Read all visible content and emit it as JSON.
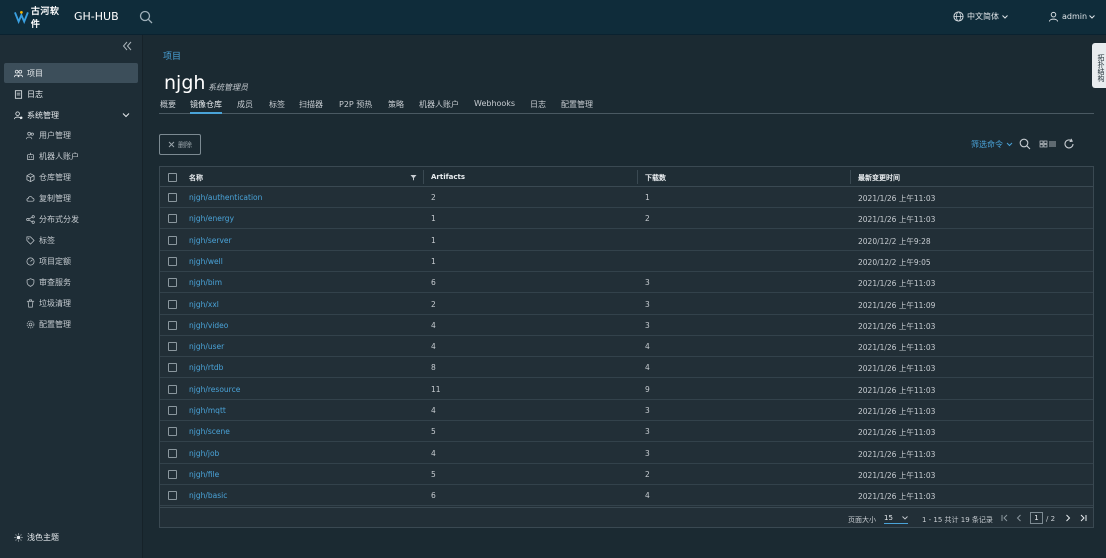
{
  "header": {
    "logo_text": "古河软件",
    "brand": "GH-HUB",
    "language": "中文简体",
    "user": "admin"
  },
  "sidebar": {
    "items": [
      {
        "label": "项目"
      },
      {
        "label": "日志"
      },
      {
        "label": "系统管理"
      }
    ],
    "sub_items": [
      {
        "label": "用户管理"
      },
      {
        "label": "机器人账户"
      },
      {
        "label": "仓库管理"
      },
      {
        "label": "复制管理"
      },
      {
        "label": "分布式分发"
      },
      {
        "label": "标签"
      },
      {
        "label": "项目定额"
      },
      {
        "label": "审查服务"
      },
      {
        "label": "垃圾清理"
      },
      {
        "label": "配置管理"
      }
    ],
    "theme": "浅色主题"
  },
  "breadcrumb": "项目",
  "project": {
    "name": "njgh",
    "role": "系统管理员"
  },
  "tabs": [
    "概要",
    "镜像仓库",
    "成员",
    "标签",
    "扫描器",
    "P2P 预热",
    "策略",
    "机器人账户",
    "Webhooks",
    "日志",
    "配置管理"
  ],
  "side_tab": "拓扑结构",
  "toolbar": {
    "delete_label": "删除",
    "filter_label": "筛选命令"
  },
  "table": {
    "columns": [
      "名称",
      "Artifacts",
      "下载数",
      "最新变更时间"
    ],
    "rows": [
      {
        "name": "njgh/authentication",
        "artifacts": "2",
        "pulls": "1",
        "time": "2021/1/26 上午11:03"
      },
      {
        "name": "njgh/energy",
        "artifacts": "1",
        "pulls": "2",
        "time": "2021/1/26 上午11:03"
      },
      {
        "name": "njgh/server",
        "artifacts": "1",
        "pulls": "",
        "time": "2020/12/2 上午9:28"
      },
      {
        "name": "njgh/well",
        "artifacts": "1",
        "pulls": "",
        "time": "2020/12/2 上午9:05"
      },
      {
        "name": "njgh/bim",
        "artifacts": "6",
        "pulls": "3",
        "time": "2021/1/26 上午11:03"
      },
      {
        "name": "njgh/xxl",
        "artifacts": "2",
        "pulls": "3",
        "time": "2021/1/26 上午11:09"
      },
      {
        "name": "njgh/video",
        "artifacts": "4",
        "pulls": "3",
        "time": "2021/1/26 上午11:03"
      },
      {
        "name": "njgh/user",
        "artifacts": "4",
        "pulls": "4",
        "time": "2021/1/26 上午11:03"
      },
      {
        "name": "njgh/rtdb",
        "artifacts": "8",
        "pulls": "4",
        "time": "2021/1/26 上午11:03"
      },
      {
        "name": "njgh/resource",
        "artifacts": "11",
        "pulls": "9",
        "time": "2021/1/26 上午11:03"
      },
      {
        "name": "njgh/mqtt",
        "artifacts": "4",
        "pulls": "3",
        "time": "2021/1/26 上午11:03"
      },
      {
        "name": "njgh/scene",
        "artifacts": "5",
        "pulls": "3",
        "time": "2021/1/26 上午11:03"
      },
      {
        "name": "njgh/job",
        "artifacts": "4",
        "pulls": "3",
        "time": "2021/1/26 上午11:03"
      },
      {
        "name": "njgh/file",
        "artifacts": "5",
        "pulls": "2",
        "time": "2021/1/26 上午11:03"
      },
      {
        "name": "njgh/basic",
        "artifacts": "6",
        "pulls": "4",
        "time": "2021/1/26 上午11:03"
      }
    ]
  },
  "pagination": {
    "page_size_label": "页面大小",
    "page_size": "15",
    "count_text": "1 - 15 共计 19 条记录",
    "current_page": "1",
    "total_pages": "/ 2"
  },
  "colors": {
    "accent": "#4aa3d8",
    "header_bg": "#0f2c3a",
    "body_bg": "#1b2a32"
  }
}
